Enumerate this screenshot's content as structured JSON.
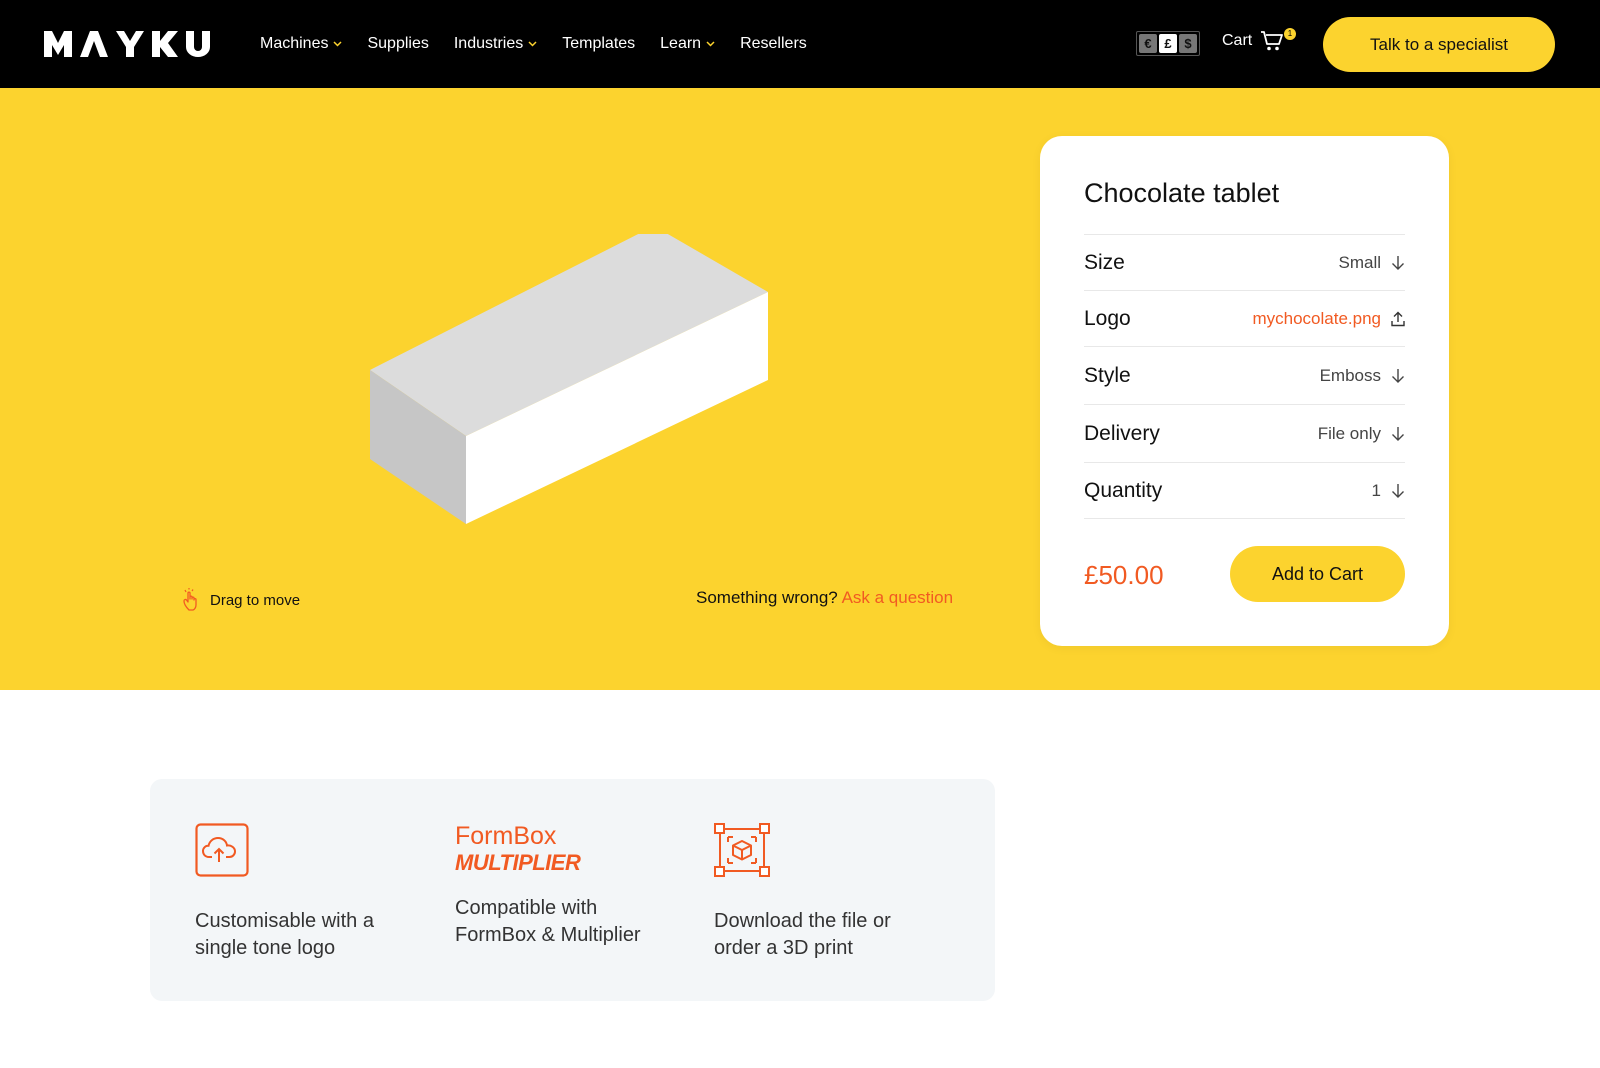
{
  "nav": {
    "logo_text": "MAYKU",
    "menu": [
      {
        "label": "Machines",
        "dropdown": true
      },
      {
        "label": "Supplies",
        "dropdown": false
      },
      {
        "label": "Industries",
        "dropdown": true
      },
      {
        "label": "Templates",
        "dropdown": false
      },
      {
        "label": "Learn",
        "dropdown": true
      },
      {
        "label": "Resellers",
        "dropdown": false
      }
    ],
    "currencies": [
      "€",
      "£",
      "$"
    ],
    "selected_currency": "£",
    "cart_label": "Cart",
    "cart_count": "1",
    "cta_label": "Talk to a specialist"
  },
  "hero": {
    "drag_hint": "Drag to move",
    "wrong_text": "Something wrong?",
    "ask_link": "Ask a question"
  },
  "product": {
    "title": "Chocolate tablet",
    "options": [
      {
        "label": "Size",
        "value": "Small",
        "icon": "arrow-down-icon"
      },
      {
        "label": "Logo",
        "value": "mychocolate.png",
        "icon": "upload-icon"
      },
      {
        "label": "Style",
        "value": "Emboss",
        "icon": "arrow-down-icon"
      },
      {
        "label": "Delivery",
        "value": "File only",
        "icon": "arrow-down-icon"
      },
      {
        "label": "Quantity",
        "value": "1",
        "icon": "arrow-down-icon"
      }
    ],
    "price": "£50.00",
    "add_to_cart": "Add to Cart"
  },
  "features": [
    {
      "icon": "cloud-upload-icon",
      "text_line1": "Customisable with a",
      "text_line2": "single tone logo"
    },
    {
      "brand_title": "FormBox",
      "brand_sub": "MULTIPLIER",
      "text_line1": "Compatible with",
      "text_line2": "FormBox & Multiplier"
    },
    {
      "icon": "3d-box-icon",
      "text_line1": "Download the file or",
      "text_line2": "order a 3D print"
    }
  ],
  "colors": {
    "accent_yellow": "#fcd32e",
    "accent_orange": "#f15a22",
    "nav_bg": "#000000",
    "feature_bg": "#f3f6f8"
  }
}
